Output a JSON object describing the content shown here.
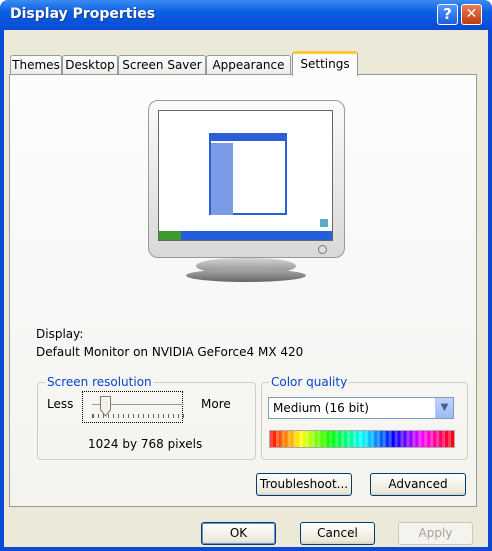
{
  "window": {
    "title": "Display Properties",
    "help_glyph": "?",
    "close_glyph": "✕"
  },
  "tabs": [
    {
      "label": "Themes"
    },
    {
      "label": "Desktop"
    },
    {
      "label": "Screen Saver"
    },
    {
      "label": "Appearance"
    },
    {
      "label": "Settings",
      "active": true
    }
  ],
  "display": {
    "label": "Display:",
    "value": "Default Monitor on NVIDIA GeForce4 MX 420"
  },
  "resolution": {
    "group_label": "Screen resolution",
    "less_label": "Less",
    "more_label": "More",
    "value_text": "1024 by 768 pixels",
    "slider_fraction": 0.1
  },
  "color_quality": {
    "group_label": "Color quality",
    "selected": "Medium (16 bit)"
  },
  "buttons": {
    "troubleshoot": "Troubleshoot...",
    "advanced": "Advanced",
    "ok": "OK",
    "cancel": "Cancel",
    "apply": "Apply"
  },
  "colors": {
    "titlebar": "#0a4ad7",
    "group_label": "#0046d5",
    "window_bg": "#ece9d8"
  }
}
